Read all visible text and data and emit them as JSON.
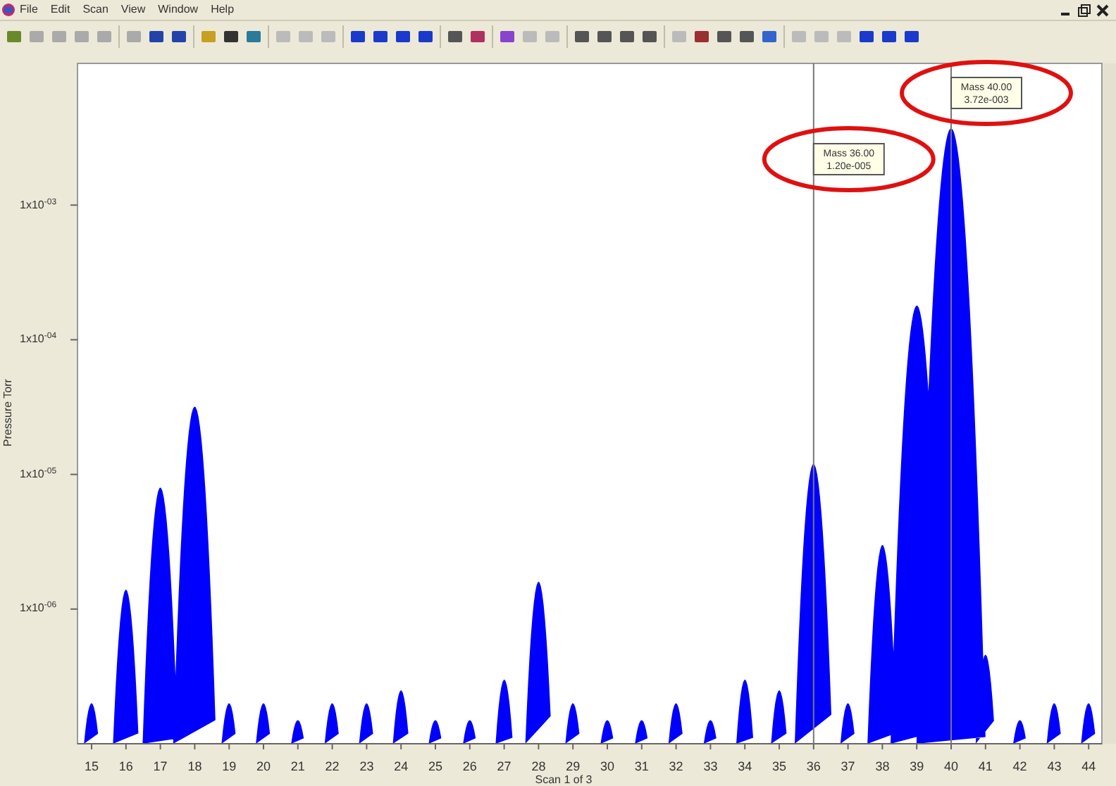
{
  "menu": [
    "File",
    "Edit",
    "Scan",
    "View",
    "Window",
    "Help"
  ],
  "plot": {
    "y_axis_title": "Pressure Torr",
    "y_tick_labels": [
      "1x10$^{-03}$",
      "1x10$^{-04}$",
      "1x10$^{-05}$",
      "1x10$^{-06}$"
    ],
    "x_tick_labels": [
      "15",
      "16",
      "17",
      "18",
      "19",
      "20",
      "21",
      "22",
      "23",
      "24",
      "25",
      "26",
      "27",
      "28",
      "29",
      "30",
      "31",
      "32",
      "33",
      "34",
      "35",
      "36",
      "37",
      "38",
      "39",
      "40",
      "41",
      "42",
      "43",
      "44"
    ],
    "cursors": [
      {
        "mass_label": "Mass 36.00",
        "value_label": "1.20e-005"
      },
      {
        "mass_label": "Mass 40.00",
        "value_label": "3.72e-003"
      }
    ],
    "scan_status": "Scan 1 of 3"
  }
}
